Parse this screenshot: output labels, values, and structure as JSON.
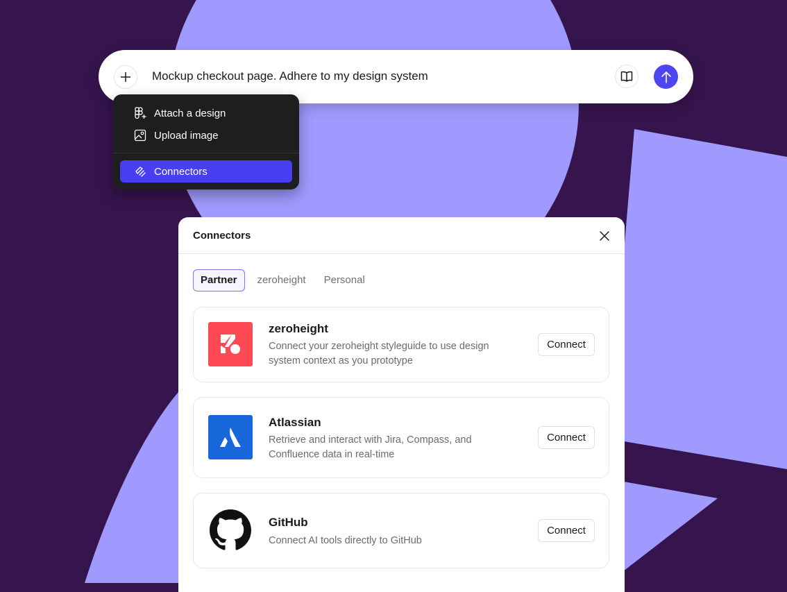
{
  "colors": {
    "background": "#36144d",
    "shape": "#a09aff",
    "accent": "#4a3ff0",
    "send": "#5046f0",
    "zeroheight": "#fe4a55",
    "atlassian": "#1868db"
  },
  "prompt": {
    "text": "Mockup checkout page. Adhere to my design system",
    "plus_icon": "plus-icon",
    "book_icon": "book-icon",
    "send_icon": "arrow-up-icon"
  },
  "menu": {
    "items": [
      {
        "label": "Attach a design",
        "icon": "figma-icon"
      },
      {
        "label": "Upload image",
        "icon": "image-icon"
      },
      {
        "label": "Connectors",
        "icon": "connectors-icon",
        "active": true
      }
    ]
  },
  "panel": {
    "title": "Connectors",
    "tabs": [
      {
        "label": "Partner",
        "active": true
      },
      {
        "label": "zeroheight"
      },
      {
        "label": "Personal"
      }
    ],
    "cards": [
      {
        "name": "zeroheight",
        "description": "Connect your zeroheight styleguide to use design system context as you prototype",
        "button": "Connect",
        "icon": "zeroheight-logo"
      },
      {
        "name": "Atlassian",
        "description": "Retrieve and interact with Jira, Compass, and Confluence data in real-time",
        "button": "Connect",
        "icon": "atlassian-logo"
      },
      {
        "name": "GitHub",
        "description": "Connect AI tools directly to GitHub",
        "button": "Connect",
        "icon": "github-logo"
      }
    ]
  }
}
